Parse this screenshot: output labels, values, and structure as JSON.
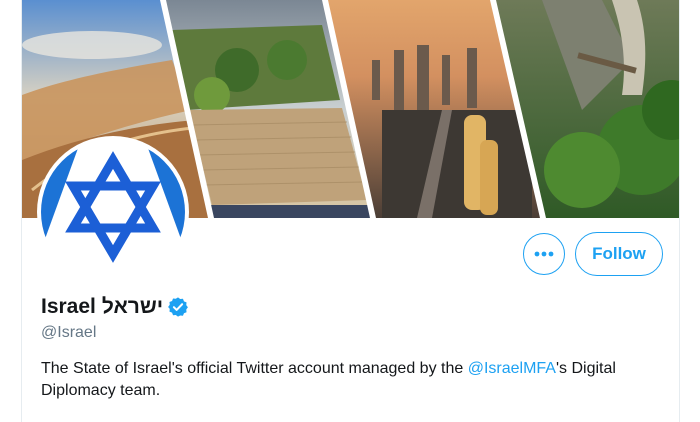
{
  "profile": {
    "display_name": "Israel",
    "hebrew_name": "ישראל",
    "handle": "@Israel",
    "verified": true,
    "bio_before": "The State of Israel's official Twitter account managed by the ",
    "bio_mention": "@IsraelMFA",
    "bio_after": "'s Digital Diplomacy team."
  },
  "actions": {
    "more_label": "•••",
    "follow_label": "Follow"
  },
  "colors": {
    "accent": "#1da1f2",
    "text": "#14171a",
    "secondary": "#657786",
    "flag_blue": "#1c5fd6"
  },
  "icons": {
    "more": "more-horizontal-icon",
    "verified": "verified-badge-icon",
    "avatar": "star-of-david-flag-avatar"
  }
}
